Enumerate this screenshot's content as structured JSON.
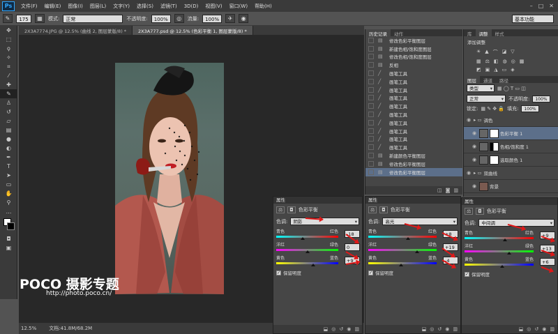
{
  "menubar": {
    "logo": "Ps",
    "items": [
      "文件(F)",
      "编辑(E)",
      "图像(I)",
      "图层(L)",
      "文字(Y)",
      "选择(S)",
      "滤镜(T)",
      "3D(D)",
      "视图(V)",
      "窗口(W)",
      "帮助(H)"
    ],
    "window_controls": [
      "–",
      "□",
      "✕"
    ]
  },
  "options": {
    "brush_size": "175",
    "mode_label": "模式:",
    "mode_value": "正常",
    "opacity_label": "不透明度:",
    "opacity_value": "100%",
    "flow_label": "流量:",
    "flow_value": "100%",
    "workspace": "基本功能"
  },
  "tabs": [
    {
      "label": "2X3A7774.JPG @ 12.5% (曲线 2, 图层蒙版/8) *",
      "active": false
    },
    {
      "label": "2X3A777.psd @ 12.5% (色彩平衡 1, 图层蒙版/8) *",
      "active": true
    }
  ],
  "status": {
    "zoom": "12.5%",
    "doc": "文档:41.8M/68.2M"
  },
  "watermark": {
    "brand": "POCO 摄影专题",
    "url": "http://photo.poco.cn/"
  },
  "history": {
    "tabs": [
      "历史记录",
      "动作"
    ],
    "items": [
      {
        "label": "修改色彩平衡图层",
        "icon": "adjust",
        "selected": false
      },
      {
        "label": "新建色相/饱和度图层",
        "icon": "adjust",
        "selected": false
      },
      {
        "label": "修改色相/饱和度图层",
        "icon": "adjust",
        "selected": false
      },
      {
        "label": "反相",
        "icon": "adjust",
        "selected": false
      },
      {
        "label": "画笔工具",
        "icon": "brush",
        "selected": false
      },
      {
        "label": "画笔工具",
        "icon": "brush",
        "selected": false
      },
      {
        "label": "画笔工具",
        "icon": "brush",
        "selected": false
      },
      {
        "label": "画笔工具",
        "icon": "brush",
        "selected": false
      },
      {
        "label": "画笔工具",
        "icon": "brush",
        "selected": false
      },
      {
        "label": "画笔工具",
        "icon": "brush",
        "selected": false
      },
      {
        "label": "画笔工具",
        "icon": "brush",
        "selected": false
      },
      {
        "label": "画笔工具",
        "icon": "brush",
        "selected": false
      },
      {
        "label": "画笔工具",
        "icon": "brush",
        "selected": false
      },
      {
        "label": "画笔工具",
        "icon": "brush",
        "selected": false
      },
      {
        "label": "新建颜色平衡图层",
        "icon": "adjust",
        "selected": false
      },
      {
        "label": "修改色彩平衡图层",
        "icon": "adjust",
        "selected": false
      },
      {
        "label": "修改色彩平衡图层",
        "icon": "adjust",
        "selected": true
      }
    ]
  },
  "adjustments": {
    "tabs": [
      "库",
      "调整",
      "样式"
    ],
    "title": "添加调整"
  },
  "layers": {
    "tabs": [
      "图层",
      "通道",
      "路径"
    ],
    "kind": "类型",
    "blend": "正常",
    "opacity_label": "不透明度:",
    "opacity": "100%",
    "lock_label": "锁定:",
    "fill_label": "填充:",
    "fill": "100%",
    "items": [
      {
        "name": "调色",
        "type": "group"
      },
      {
        "name": "色彩平衡 1",
        "type": "adjust"
      },
      {
        "name": "色相/饱和度 1",
        "type": "adjust"
      },
      {
        "name": "选取颜色 1",
        "type": "adjust"
      },
      {
        "name": "双曲线",
        "type": "group"
      },
      {
        "name": "背景",
        "type": "bg"
      }
    ]
  },
  "properties": [
    {
      "title": "属性",
      "panel_name": "色彩平衡",
      "tone_label": "色调:",
      "tone": "阴影",
      "cyan": "青色",
      "red": "红色",
      "magenta": "洋红",
      "green": "绿色",
      "yellow": "黄色",
      "blue": "蓝色",
      "values": [
        "-18",
        "0",
        "+9"
      ],
      "preserve": "保留明度"
    },
    {
      "title": "属性",
      "panel_name": "色彩平衡",
      "tone_label": "色调:",
      "tone": "高光",
      "cyan": "青色",
      "red": "红色",
      "magenta": "洋红",
      "green": "绿色",
      "yellow": "黄色",
      "blue": "蓝色",
      "values": [
        "+8",
        "+19",
        "-4"
      ],
      "preserve": "保留明度"
    },
    {
      "title": "属性",
      "panel_name": "色彩平衡",
      "tone_label": "色调:",
      "tone": "中间调",
      "cyan": "青色",
      "red": "红色",
      "magenta": "洋红",
      "green": "绿色",
      "yellow": "黄色",
      "blue": "蓝色",
      "values": [
        "+9",
        "+13",
        "+6"
      ],
      "preserve": "保留明度"
    }
  ],
  "colors": {
    "accent_arrow": "#e01818",
    "history_selected": "#5c6f8a"
  }
}
